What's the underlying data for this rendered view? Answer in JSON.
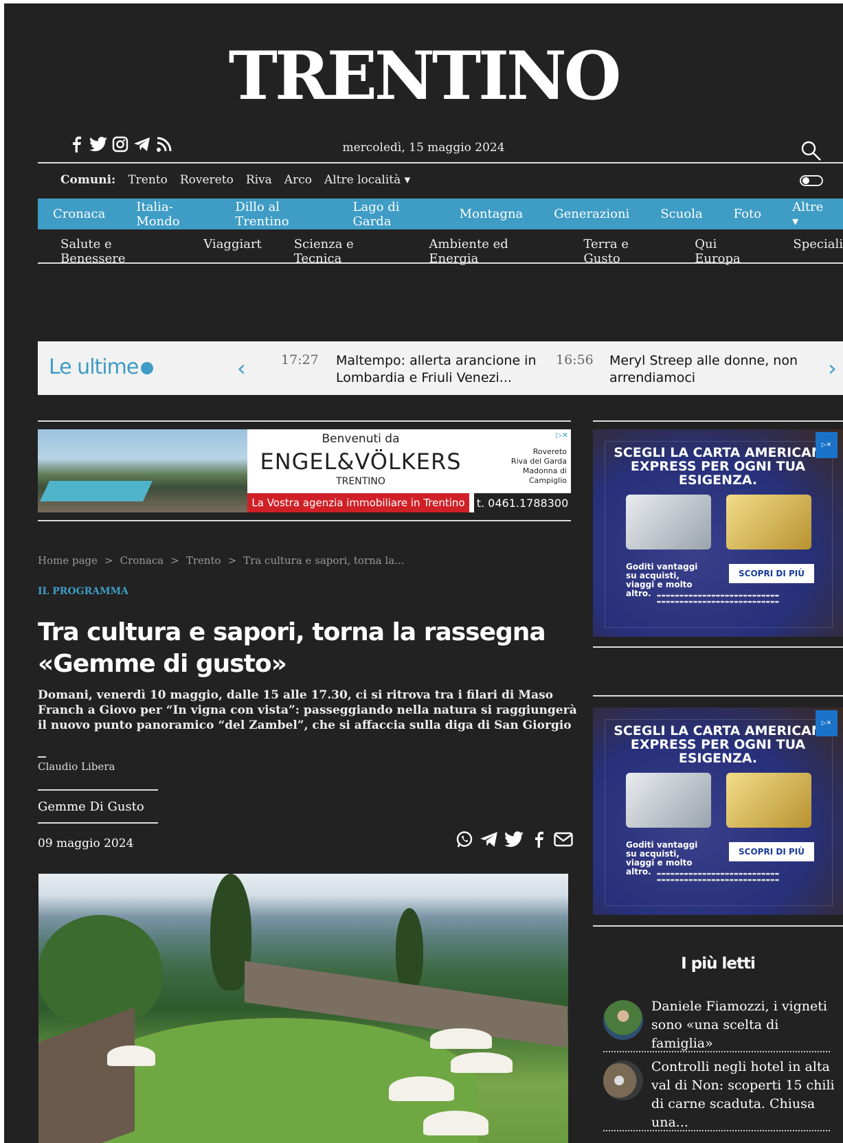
{
  "site": {
    "logo": "TRENTINO",
    "date": "mercoledì, 15 maggio 2024"
  },
  "social": [
    "facebook-icon",
    "twitter-icon",
    "instagram-icon",
    "telegram-icon",
    "rss-icon"
  ],
  "comuni": {
    "label": "Comuni:",
    "items": [
      "Trento",
      "Rovereto",
      "Riva",
      "Arco",
      "Altre località ▾"
    ]
  },
  "nav_primary": [
    "Cronaca",
    "Italia-Mondo",
    "Dillo al Trentino",
    "Lago di Garda",
    "Montagna",
    "Generazioni",
    "Scuola",
    "Foto",
    "Altre ▾"
  ],
  "nav_secondary": [
    "Salute e Benessere",
    "Viaggiart",
    "Scienza e Tecnica",
    "Ambiente ed Energia",
    "Terra e Gusto",
    "Qui Europa",
    "Speciali"
  ],
  "ticker": {
    "title": "Le ultime",
    "items": [
      {
        "time": "17:27",
        "headline": "Maltempo: allerta arancione in Lombardia e Friuli Venezi..."
      },
      {
        "time": "16:56",
        "headline": "Meryl Streep alle donne, non arrendiamoci"
      }
    ]
  },
  "banner": {
    "top": "Benvenuti da",
    "brand": "ENGEL&VÖLKERS",
    "sub": "TRENTINO",
    "locations": [
      "Rovereto",
      "Riva del Garda",
      "Madonna di Campiglio"
    ],
    "tagline": "La Vostra agenzia immobiliare in Trentino",
    "phone": "t. 0461.1788300"
  },
  "breadcrumb": [
    "Home page",
    ">",
    "Cronaca",
    ">",
    "Trento",
    ">",
    "Tra cultura e sapori, torna la..."
  ],
  "article": {
    "kicker": "IL PROGRAMMA",
    "title": "Tra cultura e sapori, torna la rassegna «Gemme di gusto»",
    "subtitle": "Domani, venerdì 10 maggio, dalle 15 alle 17.30, ci si ritrova tra i filari di Maso Franch a Giovo per “In vigna con vista”: passeggiando nella natura si raggiungerà il nuovo punto panoramico “del Zambel”, che si affaccia sulla diga di San Giorgio",
    "author": "Claudio Libera",
    "tag": "Gemme Di Gusto",
    "date": "09 maggio 2024"
  },
  "share": [
    "whatsapp-icon",
    "telegram-icon",
    "twitter-icon",
    "facebook-icon",
    "mail-icon"
  ],
  "ad_amex": {
    "headline": "SCEGLI LA CARTA AMERICAN EXPRESS PER OGNI TUA ESIGENZA.",
    "benefits": "Goditi vantaggi su acquisti, viaggi e molto altro.",
    "cta": "SCOPRI DI PIÙ"
  },
  "most_read": {
    "title": "I più letti",
    "items": [
      "Daniele Fiamozzi, i vigneti sono «una scelta di famiglia»",
      "Controlli negli hotel in alta val di Non: scoperti 15 chili di carne scaduta. Chiusa una..."
    ]
  },
  "colors": {
    "background": "#222222",
    "accent": "#3e9cc5",
    "ticker_bg": "#f2f2f2"
  }
}
